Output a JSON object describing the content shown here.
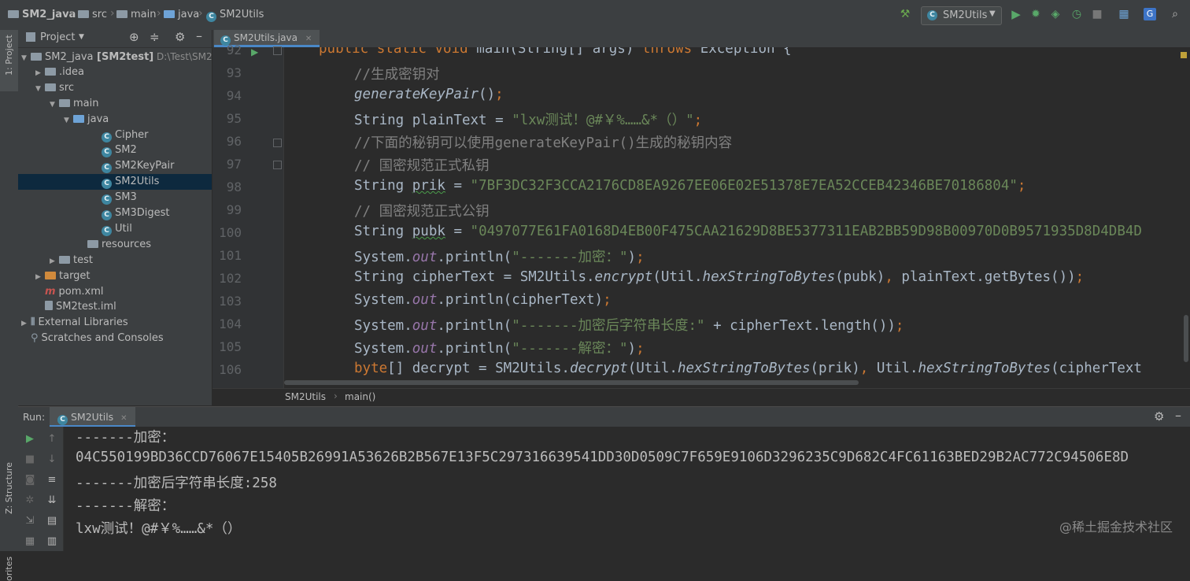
{
  "navbar": {
    "breadcrumbs": [
      "SM2_java",
      "src",
      "main",
      "java",
      "SM2Utils"
    ],
    "run_config": "SM2Utils"
  },
  "left_stripe": {
    "project_label": "1: Project",
    "structure_label": "Z: Structure",
    "favorites_label": "orites"
  },
  "project_panel": {
    "title": "Project",
    "tree": [
      {
        "label": "SM2_java",
        "bold": "[SM2test]",
        "path": "D:\\Test\\SM2_ja",
        "icon": "folder-icon",
        "expanded": true
      },
      {
        "label": ".idea",
        "icon": "folder-icon",
        "expanded": false
      },
      {
        "label": "src",
        "icon": "folder-icon",
        "expanded": true
      },
      {
        "label": "main",
        "icon": "folder-icon",
        "expanded": true
      },
      {
        "label": "java",
        "icon": "source-folder-icon",
        "expanded": true
      },
      {
        "label": "Cipher",
        "icon": "class-icon"
      },
      {
        "label": "SM2",
        "icon": "class-icon"
      },
      {
        "label": "SM2KeyPair",
        "icon": "class-icon"
      },
      {
        "label": "SM2Utils",
        "icon": "class-icon",
        "selected": true
      },
      {
        "label": "SM3",
        "icon": "class-icon"
      },
      {
        "label": "SM3Digest",
        "icon": "class-icon"
      },
      {
        "label": "Util",
        "icon": "class-icon"
      },
      {
        "label": "resources",
        "icon": "resources-folder-icon"
      },
      {
        "label": "test",
        "icon": "folder-icon",
        "expanded": false
      },
      {
        "label": "target",
        "icon": "excluded-folder-icon",
        "expanded": false
      },
      {
        "label": "pom.xml",
        "icon": "maven-icon"
      },
      {
        "label": "SM2test.iml",
        "icon": "module-file-icon"
      },
      {
        "label": "External Libraries",
        "icon": "libraries-icon",
        "expanded": false
      },
      {
        "label": "Scratches and Consoles",
        "icon": "scratches-icon"
      }
    ]
  },
  "editor": {
    "tab_label": "SM2Utils.java",
    "breadcrumb": [
      "SM2Utils",
      "main()"
    ],
    "lines": [
      {
        "n": "92",
        "tokens": [
          [
            "kw",
            "public static void "
          ],
          [
            "",
            "main"
          ],
          [
            "",
            "(String[] args) "
          ],
          [
            "kw",
            "throws "
          ],
          [
            "",
            "Exception {"
          ]
        ]
      },
      {
        "n": "93",
        "tokens": [
          [
            "cm",
            "//生成密钥对"
          ]
        ]
      },
      {
        "n": "94",
        "tokens": [
          [
            "it",
            "generateKeyPair"
          ],
          [
            "",
            ")"
          ],
          [
            "kw",
            ";"
          ]
        ]
      },
      {
        "n": "95",
        "tokens": [
          [
            "",
            "String plainText = "
          ],
          [
            "str",
            "\"lxw测试！@#￥%……&*（）\""
          ],
          [
            "kw",
            ";"
          ]
        ]
      },
      {
        "n": "96",
        "tokens": [
          [
            "cm",
            "//下面的秘钥可以使用generateKeyPair()生成的秘钥内容"
          ]
        ]
      },
      {
        "n": "97",
        "tokens": [
          [
            "cm",
            "// 国密规范正式私钥"
          ]
        ]
      },
      {
        "n": "98",
        "tokens": [
          [
            "",
            "String "
          ],
          [
            "wavy",
            "prik"
          ],
          [
            "",
            " = "
          ],
          [
            "str",
            "\"7BF3DC32F3CCA2176CD8EA9267EE06E02E51378E7EA52CCEB42346BE70186804\""
          ],
          [
            "kw",
            ";"
          ]
        ]
      },
      {
        "n": "99",
        "tokens": [
          [
            "cm",
            "// 国密规范正式公钥"
          ]
        ]
      },
      {
        "n": "100",
        "tokens": [
          [
            "",
            "String "
          ],
          [
            "wavy",
            "pubk"
          ],
          [
            "",
            " = "
          ],
          [
            "str",
            "\"0497077E61FA0168D4EB00F475CAA21629D8BE5377311EAB2BB59D98B00970D0B9571935D8D4DB4D"
          ]
        ]
      },
      {
        "n": "101",
        "tokens": [
          [
            "",
            "System."
          ],
          [
            "field",
            "out"
          ],
          [
            "",
            ".println("
          ],
          [
            "str",
            "\"-------加密：\""
          ],
          [
            "",
            ")"
          ],
          [
            "kw",
            ";"
          ]
        ]
      },
      {
        "n": "102",
        "tokens": [
          [
            "",
            "String cipherText = SM2Utils."
          ],
          [
            "it",
            "encrypt"
          ],
          [
            "",
            "(Util."
          ],
          [
            "it",
            "hexStringToBytes"
          ],
          [
            "",
            "(pubk)"
          ],
          [
            "kw",
            ", "
          ],
          [
            "",
            "plainText.getBytes())"
          ],
          [
            "kw",
            ";"
          ]
        ]
      },
      {
        "n": "103",
        "tokens": [
          [
            "",
            "System."
          ],
          [
            "field",
            "out"
          ],
          [
            "",
            ".println(cipherText)"
          ],
          [
            "kw",
            ";"
          ]
        ]
      },
      {
        "n": "104",
        "tokens": [
          [
            "",
            "System."
          ],
          [
            "field",
            "out"
          ],
          [
            "",
            ".println("
          ],
          [
            "str",
            "\"-------加密后字符串长度:\""
          ],
          [
            "",
            " + cipherText.length())"
          ],
          [
            "kw",
            ";"
          ]
        ]
      },
      {
        "n": "105",
        "tokens": [
          [
            "",
            "System."
          ],
          [
            "field",
            "out"
          ],
          [
            "",
            ".println("
          ],
          [
            "str",
            "\"-------解密：\""
          ],
          [
            "",
            ")"
          ],
          [
            "kw",
            ";"
          ]
        ]
      },
      {
        "n": "106",
        "tokens": [
          [
            "kw",
            "byte"
          ],
          [
            "",
            "[] decrypt = SM2Utils."
          ],
          [
            "it",
            "decrypt"
          ],
          [
            "",
            "(Util."
          ],
          [
            "it",
            "hexStringToBytes"
          ],
          [
            "",
            "(prik)"
          ],
          [
            "kw",
            ", "
          ],
          [
            "",
            "Util."
          ],
          [
            "it",
            "hexStringToBytes"
          ],
          [
            "",
            "(cipherText"
          ]
        ]
      }
    ]
  },
  "run_panel": {
    "label": "Run:",
    "tab_label": "SM2Utils",
    "console": [
      "-------加密：",
      "04C550199BD36CCD76067E15405B26991A53626B2B567E13F5C297316639541DD30D0509C7F659E9106D3296235C9D682C4FC61163BED29B2AC772C94506E8D",
      "-------加密后字符串长度:258",
      "-------解密：",
      "lxw测试！@#￥%……&*（）"
    ]
  },
  "watermark": "@稀土掘金技术社区",
  "colors": {
    "keyword": "#cc7832",
    "string": "#6a8759",
    "comment": "#808080",
    "field": "#9876aa",
    "selection": "#0d293e",
    "accent": "#4a88c7"
  }
}
